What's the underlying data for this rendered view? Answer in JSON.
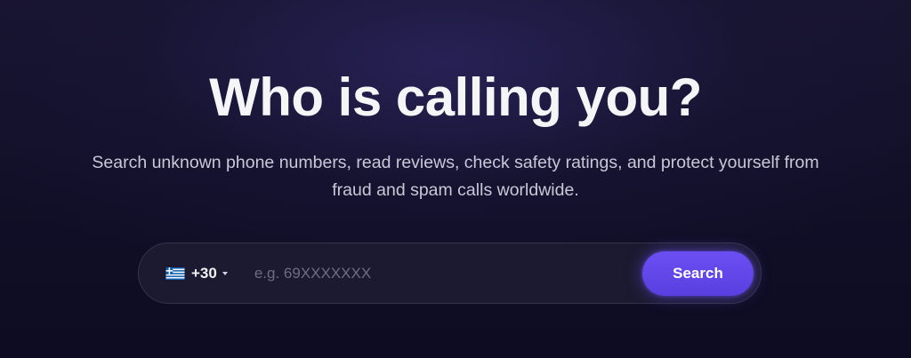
{
  "hero": {
    "title": "Who is calling you?",
    "subtitle": "Search unknown phone numbers, read reviews, check safety ratings, and protect yourself from fraud and spam calls worldwide."
  },
  "search": {
    "country": {
      "flag_icon": "greece-flag-icon",
      "code": "+30",
      "dropdown_icon": "caret-down-icon"
    },
    "placeholder": "e.g. 69XXXXXXX",
    "value": "",
    "button_label": "Search"
  },
  "colors": {
    "background": "#110f27",
    "accent": "#6b4ff2",
    "text_primary": "#f5f5f8",
    "text_secondary": "#c9c8d8",
    "placeholder": "#6d6c83"
  }
}
